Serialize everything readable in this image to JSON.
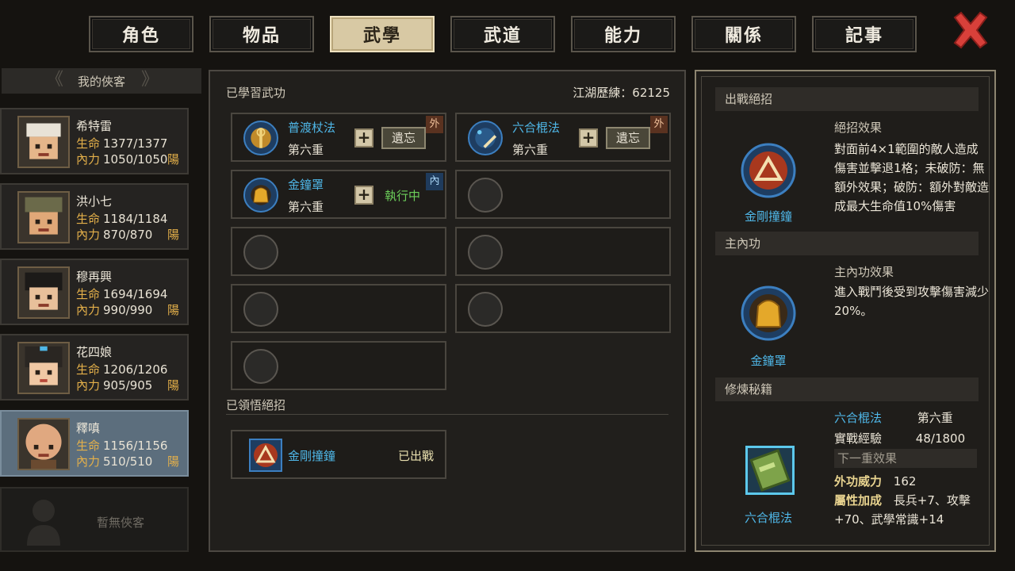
{
  "tabs": [
    "角色",
    "物品",
    "武學",
    "武道",
    "能力",
    "關係",
    "記事"
  ],
  "active_tab_index": 2,
  "roster": {
    "title": "我的俠客",
    "heroes": [
      {
        "name": "希特雷",
        "hp_label": "生命",
        "hp": "1377/1377",
        "mp_label": "內力",
        "mp": "1050/1050",
        "affinity": "陽"
      },
      {
        "name": "洪小七",
        "hp_label": "生命",
        "hp": "1184/1184",
        "mp_label": "內力",
        "mp": "870/870",
        "affinity": "陽"
      },
      {
        "name": "穆再興",
        "hp_label": "生命",
        "hp": "1694/1694",
        "mp_label": "內力",
        "mp": "990/990",
        "affinity": "陽"
      },
      {
        "name": "花四娘",
        "hp_label": "生命",
        "hp": "1206/1206",
        "mp_label": "內力",
        "mp": "905/905",
        "affinity": "陽"
      },
      {
        "name": "釋嗔",
        "hp_label": "生命",
        "hp": "1156/1156",
        "mp_label": "內力",
        "mp": "510/510",
        "affinity": "陽"
      }
    ],
    "selected_index": 4,
    "empty_label": "暫無俠客"
  },
  "learned": {
    "title": "已學習武功",
    "experience": "江湖歷練：62125",
    "skills": [
      {
        "name": "普渡杖法",
        "level": "第六重",
        "forget": "遺忘",
        "tag": "外"
      },
      {
        "name": "六合棍法",
        "level": "第六重",
        "forget": "遺忘",
        "tag": "外"
      },
      {
        "name": "金鐘罩",
        "level": "第六重",
        "status": "執行中",
        "tag": "內"
      }
    ]
  },
  "ultimates": {
    "title": "已領悟絕招",
    "items": [
      {
        "name": "金剛撞鐘",
        "status": "已出戰"
      }
    ]
  },
  "right": {
    "battle_head": "出戰絕招",
    "battle_effect_title": "絕招效果",
    "battle_effect_text": "對面前4×1範圍的敵人造成傷害並擊退1格；未破防：無額外效果；破防：額外對敵造成最大生命值10%傷害",
    "battle_caption": "金剛撞鐘",
    "inner_head": "主內功",
    "inner_effect_title": "主內功效果",
    "inner_effect_text": "進入戰鬥後受到攻擊傷害減少20%。",
    "inner_caption": "金鐘罩",
    "train_head": "修煉秘籍",
    "train_skill": "六合棍法",
    "train_level": "第六重",
    "exp_label": "實戰經驗",
    "exp_value": "48/1800",
    "next_label": "下一重效果",
    "power_label": "外功威力",
    "power_value": "162",
    "bonus_label": "屬性加成",
    "bonus_value_1": "長兵+7、攻擊",
    "bonus_value_2": "+70、武學常識+14",
    "train_caption": "六合棍法"
  },
  "colors": {
    "skill_name": "#4fb7e8",
    "stat_label": "#e4b04a",
    "running": "#6ccf5a",
    "selected_card": "#5c6e7d",
    "active_tab": "#d8c9a4",
    "close_red": "#d8403a"
  }
}
